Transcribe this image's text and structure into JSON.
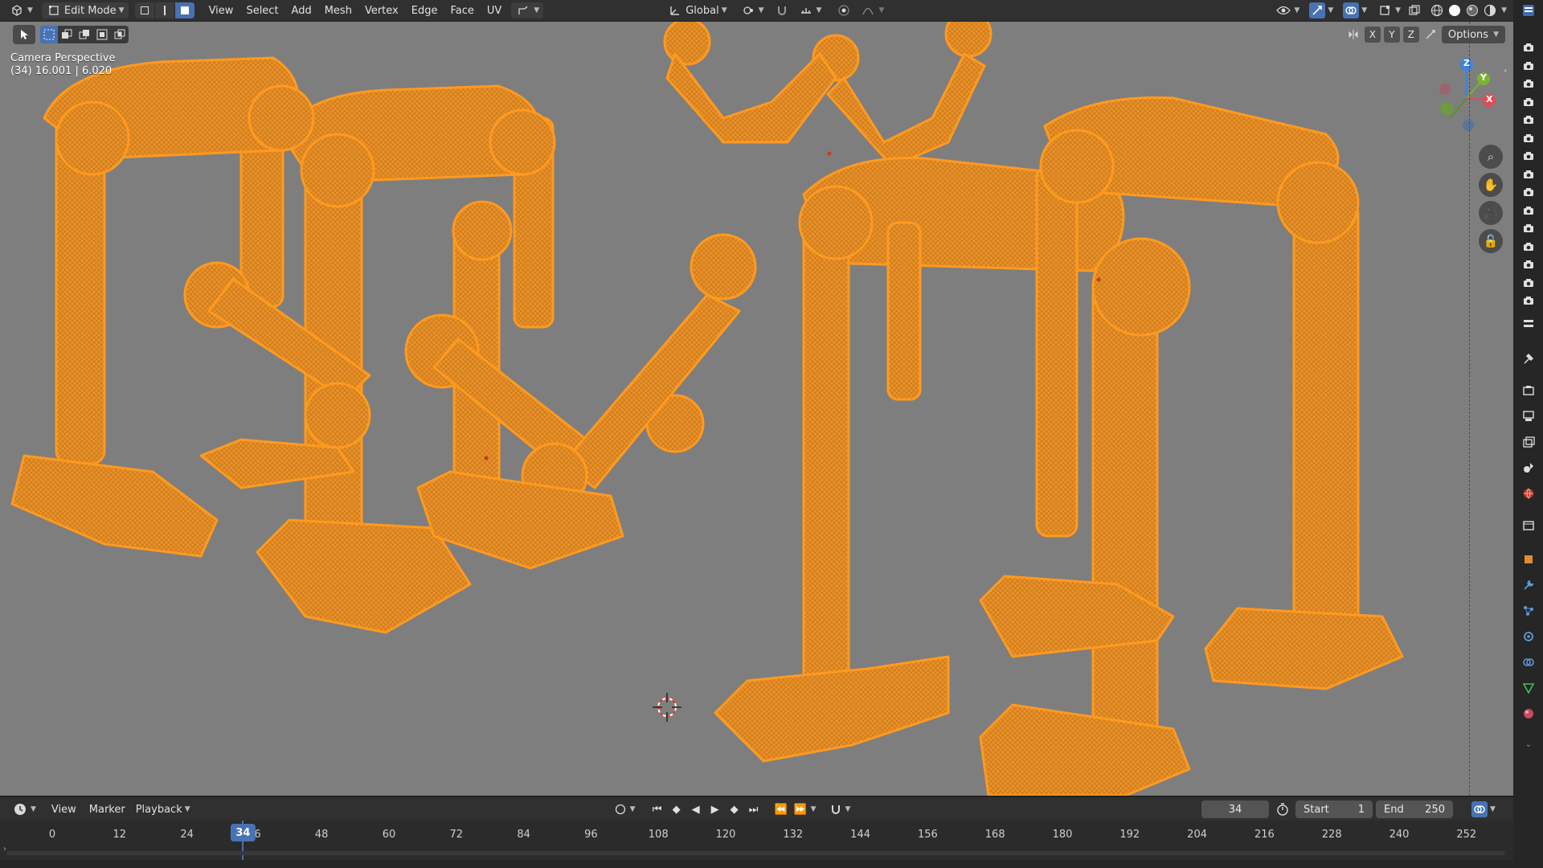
{
  "header": {
    "mode_label": "Edit Mode",
    "menus": [
      "View",
      "Select",
      "Add",
      "Mesh",
      "Vertex",
      "Edge",
      "Face",
      "UV"
    ],
    "transform_orientation": "Global"
  },
  "viewport": {
    "camera_title": "Camera Perspective",
    "camera_detail": "(34) 16.001 | 6.020",
    "axis_x": "X",
    "axis_y": "Y",
    "axis_z": "Z",
    "options_label": "Options",
    "gizmo": {
      "x": "X",
      "y": "Y",
      "z": "Z"
    }
  },
  "timeline": {
    "menus": [
      "View",
      "Marker",
      "Playback"
    ],
    "current_frame": "34",
    "start_label": "Start",
    "start_value": "1",
    "end_label": "End",
    "end_value": "250",
    "ticks": [
      "0",
      "12",
      "24",
      "36",
      "48",
      "60",
      "72",
      "84",
      "96",
      "108",
      "120",
      "132",
      "144",
      "156",
      "168",
      "180",
      "192",
      "204",
      "216",
      "228",
      "240",
      "252"
    ],
    "playhead_label": "34"
  },
  "colors": {
    "accent": "#4772b3",
    "wire": "#ff9a1f",
    "viewport_bg": "#7e7e7e"
  }
}
